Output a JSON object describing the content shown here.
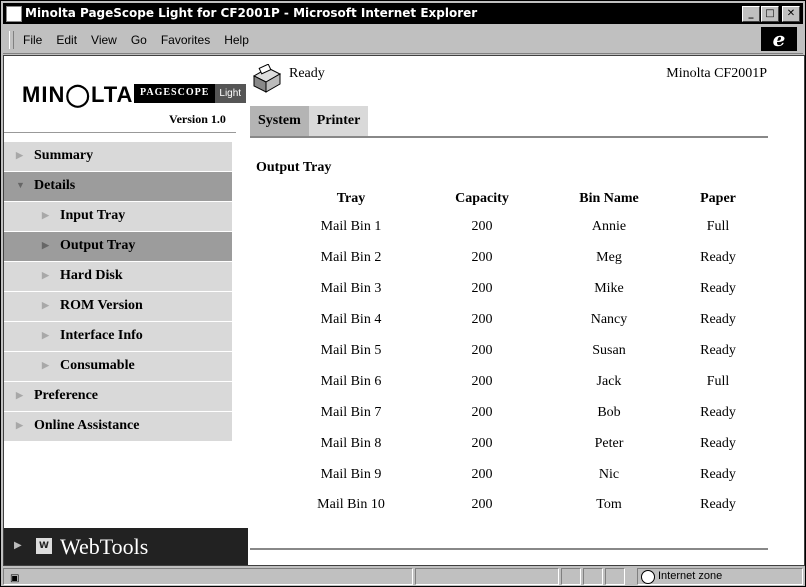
{
  "window": {
    "title": "Minolta PageScope Light for CF2001P - Microsoft Internet Explorer",
    "controls": {
      "minimize": "_",
      "maximize": "□",
      "close": "✕"
    }
  },
  "menubar": {
    "items": [
      "File",
      "Edit",
      "View",
      "Go",
      "Favorites",
      "Help"
    ],
    "logo": "e"
  },
  "brand": {
    "logo_text": "MIN◯LTA",
    "product_left": "PAGESCOPE",
    "product_right": "Light",
    "version": "Version 1.0"
  },
  "nav": {
    "items": [
      {
        "label": "Summary",
        "level": 1,
        "expanded": false
      },
      {
        "label": "Details",
        "level": 1,
        "expanded": true
      },
      {
        "label": "Input Tray",
        "level": 2
      },
      {
        "label": "Output Tray",
        "level": 2,
        "active": true
      },
      {
        "label": "Hard Disk",
        "level": 2
      },
      {
        "label": "ROM Version",
        "level": 2
      },
      {
        "label": "Interface Info",
        "level": 2
      },
      {
        "label": "Consumable",
        "level": 2
      },
      {
        "label": "Preference",
        "level": 1,
        "expanded": false
      },
      {
        "label": "Online Assistance",
        "level": 1,
        "expanded": false
      }
    ],
    "webtools": "WebTools"
  },
  "header": {
    "status": "Ready",
    "model": "Minolta CF2001P",
    "tabs": [
      {
        "label": "System",
        "active": true
      },
      {
        "label": "Printer",
        "active": false
      }
    ]
  },
  "output_tray": {
    "title": "Output Tray",
    "columns": [
      "Tray",
      "Capacity",
      "Bin Name",
      "Paper"
    ],
    "rows": [
      [
        "Mail Bin 1",
        "200",
        "Annie",
        "Full"
      ],
      [
        "Mail Bin 2",
        "200",
        "Meg",
        "Ready"
      ],
      [
        "Mail Bin 3",
        "200",
        "Mike",
        "Ready"
      ],
      [
        "Mail Bin 4",
        "200",
        "Nancy",
        "Ready"
      ],
      [
        "Mail Bin 5",
        "200",
        "Susan",
        "Ready"
      ],
      [
        "Mail Bin 6",
        "200",
        "Jack",
        "Full"
      ],
      [
        "Mail Bin 7",
        "200",
        "Bob",
        "Ready"
      ],
      [
        "Mail Bin 8",
        "200",
        "Peter",
        "Ready"
      ],
      [
        "Mail Bin 9",
        "200",
        "Nic",
        "Ready"
      ],
      [
        "Mail Bin 10",
        "200",
        "Tom",
        "Ready"
      ]
    ]
  },
  "statusbar": {
    "zone": "Internet zone"
  },
  "colors": {
    "titlebar": "#000000",
    "nav_bg": "#d9d9d9",
    "nav_active": "#9c9c9c",
    "tab_active": "#b4b4b4",
    "webtools_bg": "#222222"
  }
}
